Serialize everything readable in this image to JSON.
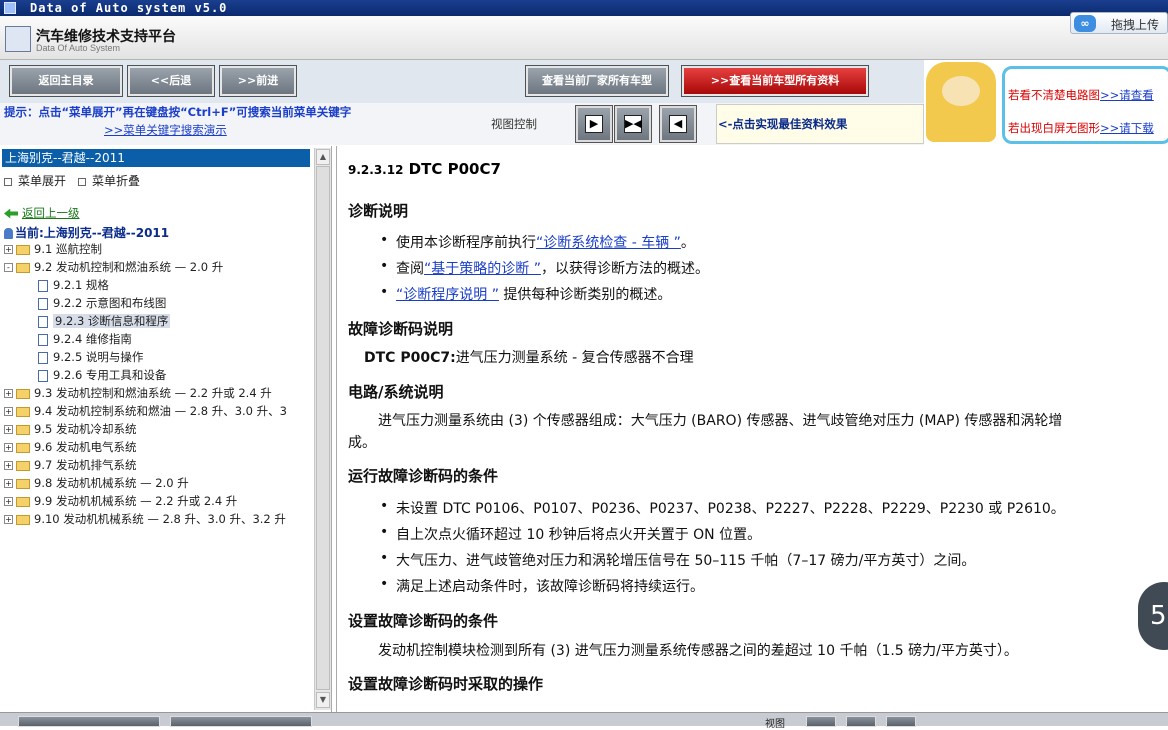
{
  "window": {
    "title": "Data of Auto system v5.0"
  },
  "brand": {
    "title": "汽车维修技术支持平台",
    "subtitle": "Data Of Auto System",
    "upload": "拖拽上传"
  },
  "toolbar": {
    "home": "返回主目录",
    "back": "<<后退",
    "forward": ">>前进",
    "all_models": "查看当前厂家所有车型",
    "current_model": ">>查看当前车型所有资料"
  },
  "hint": {
    "text": "提示：点击“菜单展开”再在键盘按“Ctrl+F”可搜索当前菜单关键字",
    "link": ">>菜单关键字搜索演示",
    "view_label": "视图控制",
    "effect": "<-点击实现最佳资料效果"
  },
  "ad": {
    "line1_text": "若看不清楚电路图",
    "line1_link": ">>请查看",
    "line2_text": "若出现白屏无图形",
    "line2_link": ">>请下载"
  },
  "left": {
    "car": "上海别克--君越--2011",
    "expand": "菜单展开",
    "collapse": "菜单折叠",
    "back_up": "返回上一级",
    "current": "当前:上海别克--君越--2011",
    "tree": [
      {
        "label": "9.1 巡航控制",
        "sign": "+"
      },
      {
        "label": "9.2 发动机控制和燃油系统 — 2.0 升",
        "sign": "-"
      },
      {
        "label": "9.2.1 规格"
      },
      {
        "label": "9.2.2 示意图和布线图"
      },
      {
        "label": "9.2.3 诊断信息和程序"
      },
      {
        "label": "9.2.4 维修指南"
      },
      {
        "label": "9.2.5 说明与操作"
      },
      {
        "label": "9.2.6 专用工具和设备"
      },
      {
        "label": "9.3 发动机控制和燃油系统 — 2.2 升或 2.4 升",
        "sign": "+"
      },
      {
        "label": "9.4 发动机控制系统和燃油 — 2.8 升、3.0 升、3",
        "sign": "+"
      },
      {
        "label": "9.5 发动机冷却系统",
        "sign": "+"
      },
      {
        "label": "9.6 发动机电气系统",
        "sign": "+"
      },
      {
        "label": "9.7 发动机排气系统",
        "sign": "+"
      },
      {
        "label": "9.8 发动机机械系统 — 2.0 升",
        "sign": "+"
      },
      {
        "label": "9.9 发动机机械系统 — 2.2 升或 2.4 升",
        "sign": "+"
      },
      {
        "label": "9.10 发动机机械系统 — 2.8 升、3.0 升、3.2 升",
        "sign": "+"
      }
    ]
  },
  "doc": {
    "num": "9.2.3.12",
    "code": "DTC P00C7",
    "h_diag": "诊断说明",
    "b1_pre": "使用本诊断程序前执行",
    "b1_link": "“诊断系统检查 - 车辆 ”",
    "b1_post": "。",
    "b2_pre": "查阅",
    "b2_link": "“基于策略的诊断 ”",
    "b2_post": "，以获得诊断方法的概述。",
    "b3_link": "“诊断程序说明 ”",
    "b3_post": "提供每种诊断类别的概述。",
    "h_dtc": "故障诊断码说明",
    "dtc_code": "DTC P00C7:",
    "dtc_desc": "进气压力测量系统 - 复合传感器不合理",
    "h_circuit": "电路/系统说明",
    "circuit_l1": "进气压力测量系统由 (3) 个传感器组成：大气压力 (BARO) 传感器、进气歧管绝对压力 (MAP) 传感器和涡轮增",
    "circuit_l2": "成。",
    "h_run": "运行故障诊断码的条件",
    "run_b1": "未设置 DTC P0106、P0107、P0236、P0237、P0238、P2227、P2228、P2229、P2230 或 P2610。",
    "run_b2": "自上次点火循环超过 10 秒钟后将点火开关置于 ON 位置。",
    "run_b3": "大气压力、进气歧管绝对压力和涡轮增压信号在 50–115 千帕（7–17 磅力/平方英寸）之间。",
    "run_b4": "满足上述启动条件时，该故障诊断码将持续运行。",
    "h_set": "设置故障诊断码的条件",
    "set_p": "发动机控制模块检测到所有 (3) 进气压力测量系统传感器之间的差超过 10 千帕（1.5 磅力/平方英寸）。",
    "h_action": "设置故障诊断码时采取的操作"
  },
  "badge": "5",
  "bottom": {
    "view": "视图"
  }
}
